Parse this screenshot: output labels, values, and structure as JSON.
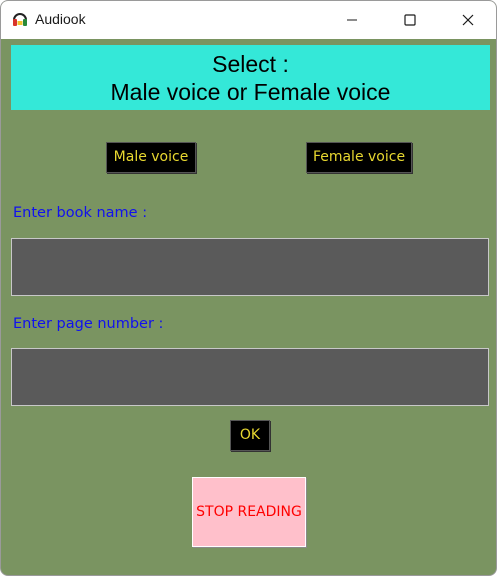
{
  "window": {
    "title": "Audiook",
    "app_icon": "headphones-icon",
    "controls": [
      "minimize-icon",
      "maximize-icon",
      "close-icon"
    ]
  },
  "header": {
    "line1": "Select :",
    "line2": "Male voice or Female voice"
  },
  "voice_buttons": {
    "male_label": "Male voice",
    "female_label": "Female voice"
  },
  "form": {
    "book_label": "Enter book name :",
    "book_value": "",
    "page_label": "Enter page number :",
    "page_value": ""
  },
  "actions": {
    "ok_label": "OK",
    "stop_label": "STOP READING"
  },
  "colors": {
    "window_bg": "#7a9461",
    "header_bg": "#34e8d8",
    "button_bg": "#000000",
    "button_text": "#e8d830",
    "label_text": "#1111ee",
    "field_bg": "#5a5a5a",
    "stop_bg": "#ffc0cb",
    "stop_text": "#ff0000"
  }
}
